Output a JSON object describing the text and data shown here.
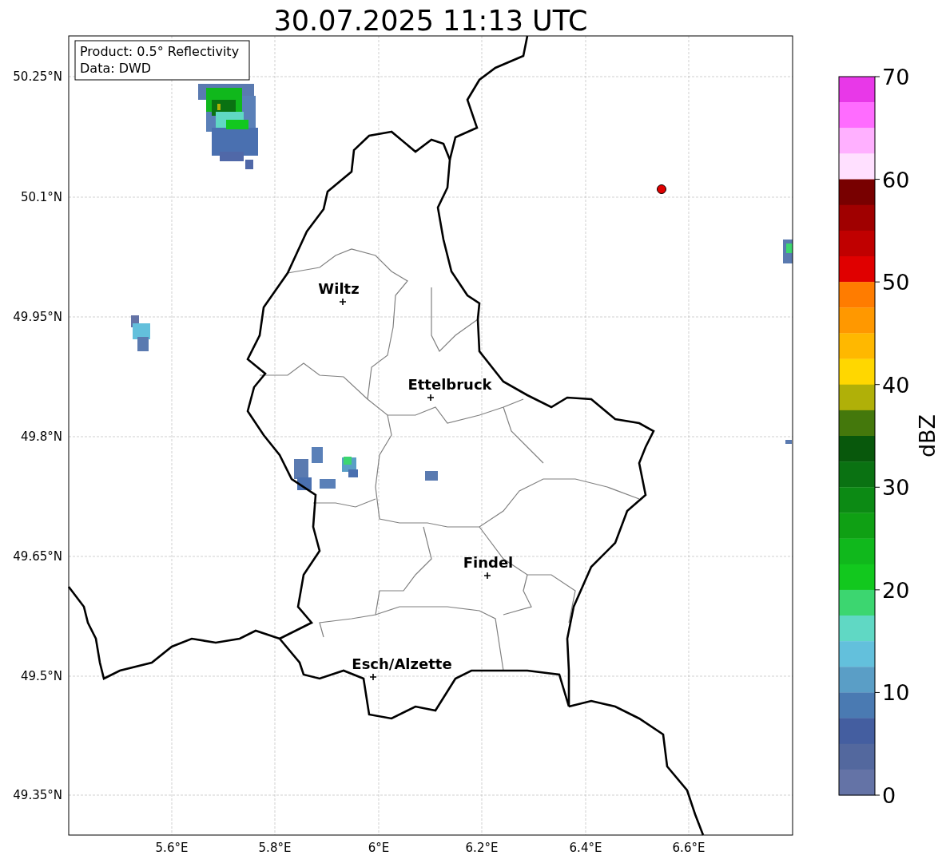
{
  "title": "30.07.2025 11:13 UTC",
  "info_box": [
    "Product: 0.5° Reflectivity",
    "Data: DWD"
  ],
  "y_ticks": [
    "50.25°N",
    "50.1°N",
    "49.95°N",
    "49.8°N",
    "49.65°N",
    "49.5°N",
    "49.35°N"
  ],
  "x_ticks": [
    "5.6°E",
    "5.8°E",
    "6°E",
    "6.2°E",
    "6.4°E",
    "6.6°E"
  ],
  "cities": [
    {
      "name": "Wiltz"
    },
    {
      "name": "Ettelbruck"
    },
    {
      "name": "Findel"
    },
    {
      "name": "Esch/Alzette"
    }
  ],
  "colorbar": {
    "label": "dBZ",
    "ticks": [
      "70",
      "60",
      "50",
      "40",
      "30",
      "20",
      "10",
      "0"
    ],
    "bins": [
      {
        "color": "#e838e8"
      },
      {
        "color": "#ff6cff"
      },
      {
        "color": "#ffb0ff"
      },
      {
        "color": "#ffe0ff"
      },
      {
        "color": "#780000"
      },
      {
        "color": "#a00000"
      },
      {
        "color": "#c00000"
      },
      {
        "color": "#e00000"
      },
      {
        "color": "#ff7c00"
      },
      {
        "color": "#ff9800"
      },
      {
        "color": "#ffb800"
      },
      {
        "color": "#ffd700"
      },
      {
        "color": "#b0b008"
      },
      {
        "color": "#44780c"
      },
      {
        "color": "#08580c"
      },
      {
        "color": "#0a7212"
      },
      {
        "color": "#0c8a14"
      },
      {
        "color": "#0fa014"
      },
      {
        "color": "#10b81c"
      },
      {
        "color": "#12c81e"
      },
      {
        "color": "#3cd670"
      },
      {
        "color": "#60d8c4"
      },
      {
        "color": "#63c0dc"
      },
      {
        "color": "#5a9ec6"
      },
      {
        "color": "#4a7ab2"
      },
      {
        "color": "#445ea0"
      },
      {
        "color": "#53689e"
      },
      {
        "color": "#6473a6"
      }
    ]
  }
}
